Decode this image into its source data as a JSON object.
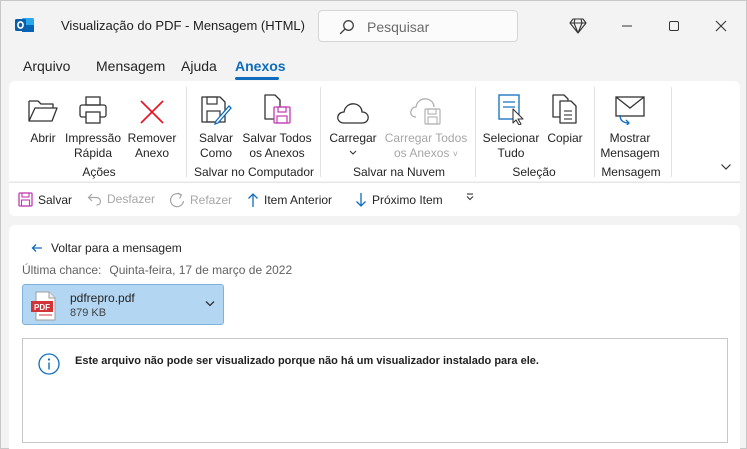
{
  "window": {
    "title": "Visualização do PDF - Mensagem (HTML)",
    "search_placeholder": "Pesquisar"
  },
  "tabs": [
    {
      "label": "Arquivo"
    },
    {
      "label": "Mensagem"
    },
    {
      "label": "Ajuda"
    },
    {
      "label": "Anexos",
      "active": true
    }
  ],
  "ribbon": {
    "groups": {
      "acoes": "Ações",
      "salvar_computador": "Salvar no Computador",
      "salvar_nuvem": "Salvar na Nuvem",
      "selecao": "Seleção",
      "mensagem": "Mensagem"
    },
    "buttons": {
      "abrir": "Abrir",
      "impressao_1": "Impressão",
      "impressao_2": "Rápida",
      "remover_1": "Remover",
      "remover_2": "Anexo",
      "salvar_como_1": "Salvar",
      "salvar_como_2": "Como",
      "salvar_todos_1": "Salvar Todos",
      "salvar_todos_2": "os Anexos",
      "carregar": "Carregar",
      "carregar_todos_1": "Carregar Todos",
      "carregar_todos_2": "os Anexos",
      "selecionar_1": "Selecionar",
      "selecionar_2": "Tudo",
      "copiar": "Copiar",
      "mostrar_1": "Mostrar",
      "mostrar_2": "Mensagem"
    }
  },
  "quick_toolbar": {
    "salvar": "Salvar",
    "desfazer": "Desfazer",
    "refazer": "Refazer",
    "item_anterior": "Item Anterior",
    "proximo_item": "Próximo Item"
  },
  "content": {
    "back_link": "Voltar para a mensagem",
    "last_chance_label": "Última chance:",
    "last_chance_value": "Quinta-feira, 17 de março de 2022",
    "attachment": {
      "badge": "PDF",
      "name": "pdfrepro.pdf",
      "size": "879 KB"
    },
    "info_message": "Este arquivo não pode ser visualizado porque não há um visualizador instalado para ele."
  },
  "colors": {
    "accent": "#0f6cbd",
    "attachment_bg": "#b3d6f2",
    "remove_red": "#e81123",
    "pdf_red": "#d13438"
  }
}
